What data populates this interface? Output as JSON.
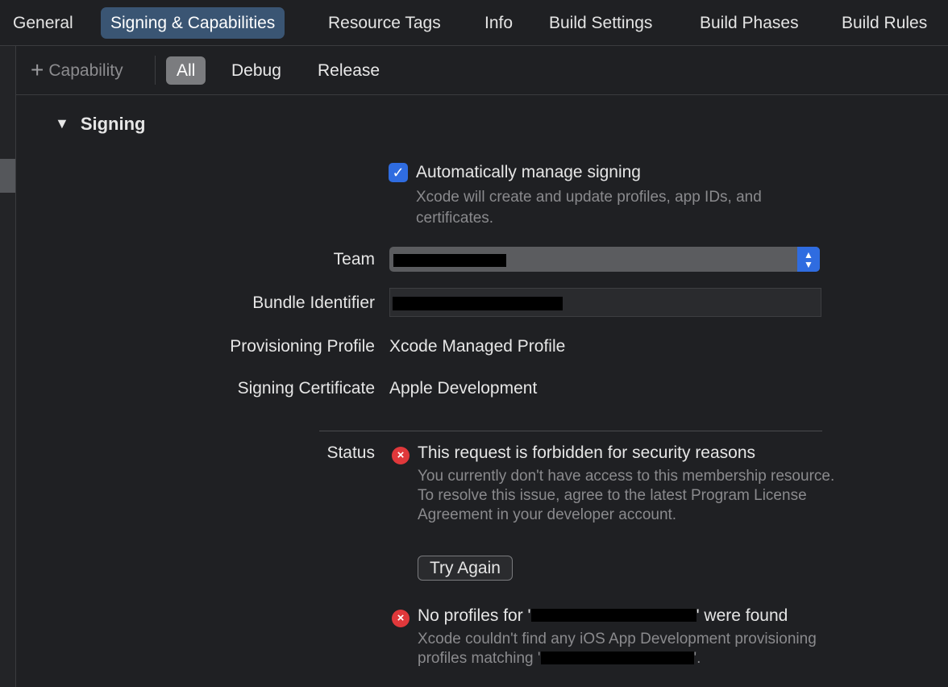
{
  "tabs": [
    {
      "label": "General"
    },
    {
      "label": "Signing & Capabilities"
    },
    {
      "label": "Resource Tags"
    },
    {
      "label": "Info"
    },
    {
      "label": "Build Settings"
    },
    {
      "label": "Build Phases"
    },
    {
      "label": "Build Rules"
    }
  ],
  "active_tab": "Signing & Capabilities",
  "subbar": {
    "capability_label": "Capability",
    "configs": [
      "All",
      "Debug",
      "Release"
    ],
    "active_config": "All"
  },
  "signing": {
    "section_title": "Signing",
    "auto_manage_label": "Automatically manage signing",
    "auto_manage_checked": true,
    "auto_manage_desc": "Xcode will create and update profiles, app IDs, and certificates.",
    "team_label": "Team",
    "bundle_id_label": "Bundle Identifier",
    "provisioning_label": "Provisioning Profile",
    "provisioning_value": "Xcode Managed Profile",
    "certificate_label": "Signing Certificate",
    "certificate_value": "Apple Development",
    "status_label": "Status",
    "errors": [
      {
        "title": "This request is forbidden for security reasons",
        "desc": "You currently don't have access to this membership resource. To resolve this issue, agree to the latest Program License Agreement in your developer account."
      },
      {
        "title_prefix": "No profiles for '",
        "title_suffix": "' were found",
        "desc_prefix": "Xcode couldn't find any iOS App Development provisioning profiles matching '",
        "desc_suffix": "'."
      }
    ],
    "try_again_label": "Try Again"
  },
  "colors": {
    "accent": "#2f6ce0",
    "active_tab_bg": "#3a5573",
    "error": "#e0383b",
    "background": "#1f2023"
  }
}
